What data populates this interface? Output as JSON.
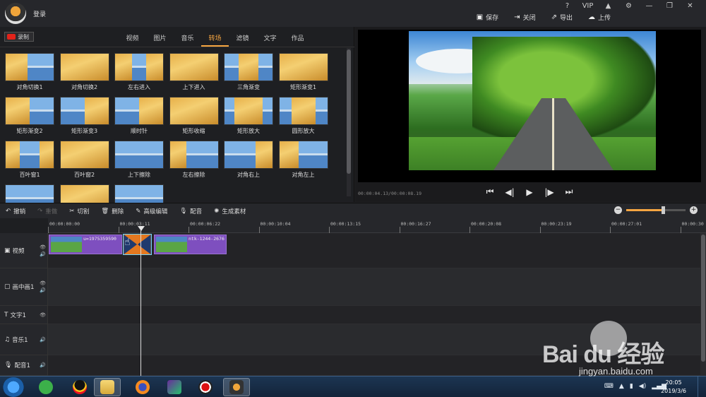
{
  "app": {
    "login_label": "登录",
    "window_controls": [
      "?",
      "VIP",
      "▲",
      "⚙",
      "—",
      "❐",
      "✕"
    ]
  },
  "header_actions": [
    {
      "icon": "save-icon",
      "label": "保存"
    },
    {
      "icon": "close-icon",
      "label": "关闭"
    },
    {
      "icon": "export-icon",
      "label": "导出"
    },
    {
      "icon": "upload-icon",
      "label": "上传"
    }
  ],
  "library": {
    "record_label": "录制",
    "tabs": [
      "视频",
      "图片",
      "音乐",
      "转场",
      "滤镜",
      "文字",
      "作品"
    ],
    "active_tab": "转场",
    "items": [
      "对角切换1",
      "对角切换2",
      "左右进入",
      "上下进入",
      "三角渐变",
      "矩形渐变1",
      "矩形渐变2",
      "矩形渐变3",
      "顺时针",
      "矩形收缩",
      "矩形放大",
      "圆形放大",
      "百叶窗1",
      "百叶窗2",
      "上下擦除",
      "左右擦除",
      "对角右上",
      "对角左上",
      "",
      "",
      ""
    ]
  },
  "preview": {
    "timecode": "00:00:04.13/00:00:08.19",
    "controls": [
      "skip-back-icon",
      "step-back-icon",
      "play-icon",
      "step-forward-icon",
      "skip-forward-icon"
    ]
  },
  "toolbar": {
    "undo": "撤销",
    "redo": "重做",
    "cut": "切割",
    "delete": "删除",
    "advanced_edit": "高级编辑",
    "dub": "配音",
    "generate": "生成素材",
    "zoom_level": 0.62
  },
  "timeline": {
    "ruler": [
      "00:00:00:00",
      "00:00:03:11",
      "00:00:06:22",
      "00:00:10:04",
      "00:00:13:15",
      "00:00:16:27",
      "00:00:20:08",
      "00:00:23:19",
      "00:00:27:01",
      "00:00:30"
    ],
    "tracks": [
      {
        "label": "视频",
        "icon": "video-icon",
        "controls": "👁🔊"
      },
      {
        "label": "画中画1",
        "icon": "pip-icon",
        "controls": "👁🔊"
      },
      {
        "label": "文字1",
        "icon": "text-icon",
        "controls": "👁"
      },
      {
        "label": "音乐1",
        "icon": "music-icon",
        "controls": "🔊"
      },
      {
        "label": "配音1",
        "icon": "mic-icon",
        "controls": "🔊"
      }
    ],
    "clips": [
      {
        "name": "u=1975359590"
      },
      {
        "name": "ntk-1244-2676"
      }
    ]
  },
  "taskbar": {
    "clock_time": "20:05",
    "clock_date": "2019/3/6"
  },
  "watermark": {
    "brand": "Bai du 经验",
    "url": "jingyan.baidu.com"
  },
  "colors": {
    "accent": "#f5a541",
    "clip": "#7e4fbf",
    "transition": "#e37820",
    "record": "#e2231a"
  }
}
